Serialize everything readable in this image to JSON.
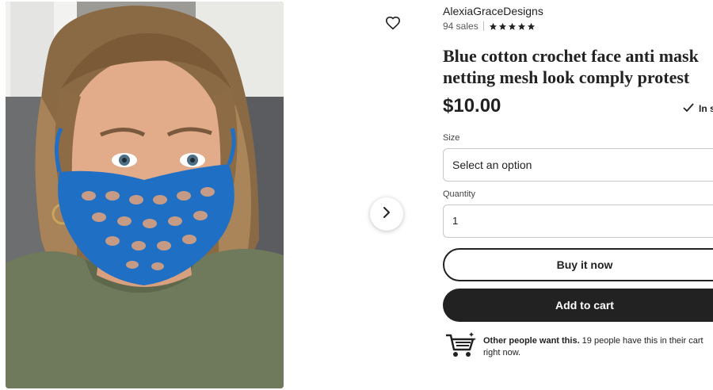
{
  "listing": {
    "shop_name": "AlexiaGraceDesigns",
    "sales": "94 sales",
    "rating_stars": 5,
    "title_line1": "Blue cotton crochet face anti mask",
    "title_line2": "netting mesh look comply protest",
    "price": "$10.00",
    "stock_text": "In s"
  },
  "icons": {
    "favorite": "heart-outline-icon",
    "next": "chevron-right-icon",
    "star": "star-icon",
    "check": "checkmark-icon",
    "cart": "shopping-cart-icon"
  },
  "form": {
    "size_label": "Size",
    "size_value": "Select an option",
    "quantity_label": "Quantity",
    "quantity_value": "1"
  },
  "buttons": {
    "buy_now": "Buy it now",
    "add_to_cart": "Add to cart"
  },
  "nudge": {
    "bold": "Other people want this.",
    "rest": " 19 people have this in their cart",
    "line2": "right now."
  },
  "colors": {
    "primary_dark": "#222222",
    "mask_blue": "#1f6fc4",
    "border": "#c8c8c8"
  }
}
